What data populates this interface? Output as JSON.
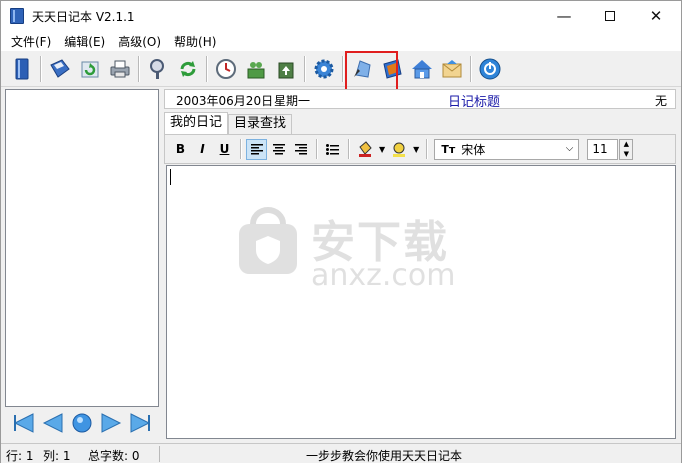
{
  "window": {
    "title": "天天日记本 V2.1.1",
    "controls": {
      "minimize": "—",
      "close": "✕"
    }
  },
  "menu": [
    {
      "label": "文件(F)"
    },
    {
      "label": "编辑(E)"
    },
    {
      "label": "高级(O)"
    },
    {
      "label": "帮助(H)"
    }
  ],
  "toolbar_icons": [
    "notebook-icon",
    "save-disk-icon",
    "refresh-icon",
    "print-icon",
    "search-icon",
    "sync-icon",
    "clock-icon",
    "user-group-icon",
    "user-add-icon",
    "settings-gear-icon",
    "pen-tool-icon",
    "blue-book-icon",
    "home-icon",
    "mail-icon",
    "power-icon"
  ],
  "header": {
    "date": "2003年06月20日",
    "weekday": "星期一",
    "title": "日记标题",
    "weather": "无"
  },
  "tabs": [
    {
      "label": "我的日记",
      "active": true
    },
    {
      "label": "目录查找",
      "active": false
    }
  ],
  "format": {
    "bold": "B",
    "italic": "I",
    "underline": "U",
    "font_prefix": "Tт",
    "font_name": "宋体",
    "font_size": "11"
  },
  "editor": {
    "content": ""
  },
  "watermark": {
    "text": "安下载",
    "sub": "anxz.com"
  },
  "status": {
    "row": "行: 1",
    "col": "列: 1",
    "count": "总字数: 0",
    "message": "一步步教会你使用天天日记本"
  },
  "colors": {
    "accent": "#1a1aa8",
    "highlight": "#e01e1e"
  }
}
